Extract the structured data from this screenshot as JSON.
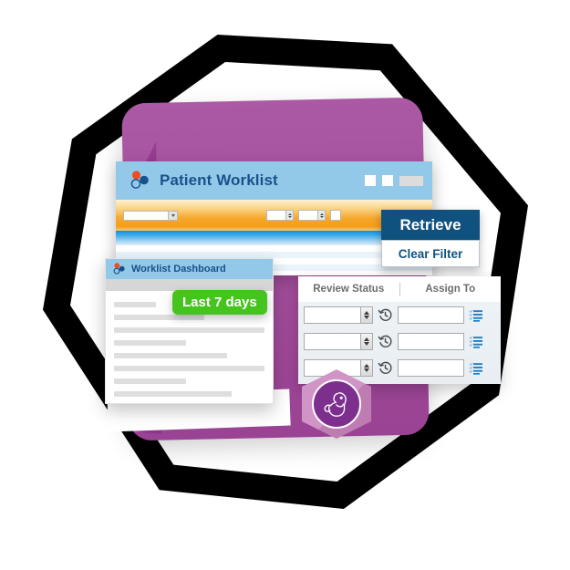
{
  "artwork": {
    "theme": "healthcare-patient-worklist-illustration",
    "colors": {
      "hex_outline": "#000000",
      "purple_card": "#a4509d",
      "purple_card_dark": "#963d90",
      "titlebar_blue": "#93c9e8",
      "title_text_blue": "#17528c",
      "toolbar_orange": "#f6a72a",
      "button_navy": "#10527f",
      "badge_green": "#46c41e",
      "badge_purple": "#7d2f8e",
      "placeholder_gray": "#dedede"
    }
  },
  "main_window": {
    "title": "Patient Worklist",
    "logo_icon": "brand-dots-icon",
    "window_controls": [
      {
        "name": "minimize-button",
        "style": "square"
      },
      {
        "name": "maximize-button",
        "style": "square"
      },
      {
        "name": "close-button",
        "style": "wide"
      }
    ],
    "toolbar": {
      "filter_select": {
        "icon": "chevron-down-icon",
        "value": ""
      },
      "spinner_one": {
        "value": ""
      },
      "spinner_two": {
        "value": ""
      },
      "small_button": {
        "label": ""
      }
    }
  },
  "actions": {
    "retrieve_label": "Retrieve",
    "clear_filter_label": "Clear Filter"
  },
  "data_panel": {
    "columns": [
      "Review Status",
      "Assign To"
    ],
    "rows": [
      {
        "review_status": "",
        "assign_to": "",
        "history_icon": "clock-history-icon",
        "lookup_icon": "list-lookup-icon"
      },
      {
        "review_status": "",
        "assign_to": "",
        "history_icon": "clock-history-icon",
        "lookup_icon": "list-lookup-icon"
      },
      {
        "review_status": "",
        "assign_to": "",
        "history_icon": "clock-history-icon",
        "lookup_icon": "list-lookup-icon"
      }
    ]
  },
  "dashboard_window": {
    "title": "Worklist Dashboard",
    "logo_icon": "brand-dots-icon",
    "date_badge": "Last 7 days",
    "placeholder_bars": [
      28,
      60,
      100,
      48,
      75,
      100,
      48,
      78
    ]
  },
  "specialty_badge": {
    "icon": "fetus-icon",
    "shape": "hexagon"
  }
}
